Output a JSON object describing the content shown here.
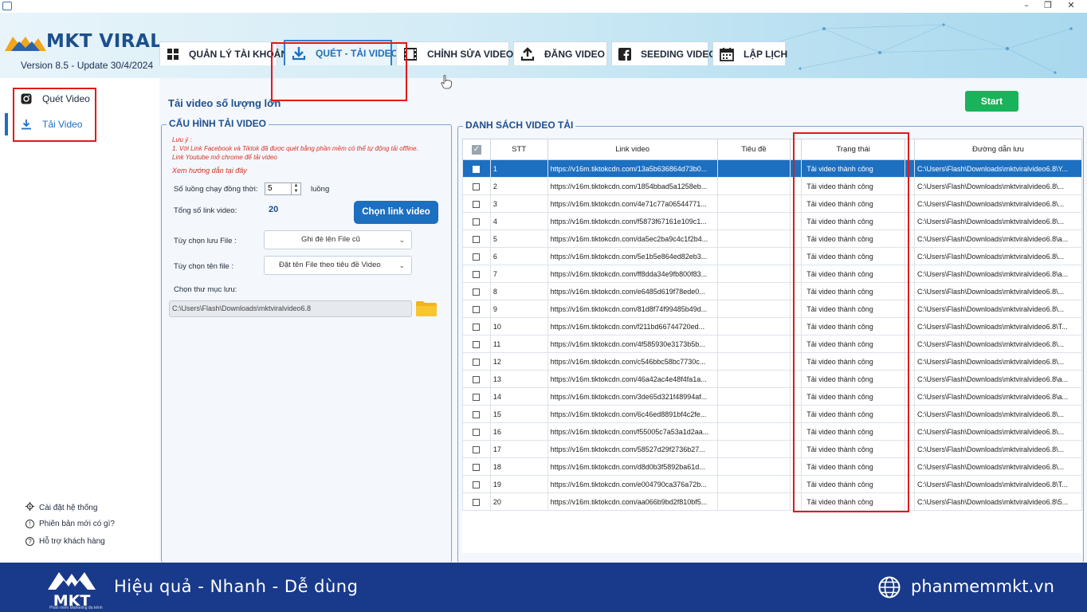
{
  "app": {
    "brand": "MKT VIRAL",
    "version": "Version  8.5 - Update 30/4/2024",
    "window_controls": [
      "–",
      "❐",
      "✕"
    ]
  },
  "tabs": [
    {
      "label": "QUẢN LÝ TÀI KHOẢN",
      "icon": "account-grid-icon"
    },
    {
      "label": "QUÉT - TẢI VIDEO",
      "icon": "download-icon",
      "active": true
    },
    {
      "label": "CHỈNH SỬA VIDEO",
      "icon": "film-icon"
    },
    {
      "label": "ĐĂNG VIDEO",
      "icon": "upload-icon"
    },
    {
      "label": "SEEDING VIDEO",
      "icon": "facebook-icon"
    },
    {
      "label": "LẬP LỊCH",
      "icon": "calendar-icon"
    }
  ],
  "sidebar": {
    "items": [
      {
        "label": "Quét Video",
        "icon": "instagram-icon"
      },
      {
        "label": "Tải Video",
        "icon": "download-icon",
        "active": true
      }
    ],
    "bottom": [
      {
        "label": "Cài đặt hệ thống",
        "icon": "gear-icon"
      },
      {
        "label": "Phiên bản mới có gì?",
        "icon": "info-icon"
      },
      {
        "label": "Hỗ trợ khách hàng",
        "icon": "help-icon"
      }
    ]
  },
  "main": {
    "title": "Tải video số lượng lớn",
    "start_label": "Start",
    "config": {
      "title": "CẤU HÌNH TẢI VIDEO",
      "note_lines": [
        "Lưu ý :",
        "1. Với Link Facebook và Tiktok đã được quét bằng phần mềm có thể tự động tải offline.",
        "Link Youtube mở chrome để tải video"
      ],
      "guide_link": "Xem hướng dẫn tại đây",
      "threads_label": "Số luồng chạy đồng thời:",
      "threads_value": "5",
      "threads_unit": "luồng",
      "total_label": "Tổng số link video:",
      "total_value": "20",
      "choose_button": "Chọn link video",
      "save_option_label": "Tùy chọn lưu File :",
      "save_option_value": "Ghi đè lên File cũ",
      "name_option_label": "Tùy chọn tên file :",
      "name_option_value": "Đặt tên File theo tiêu đề Video",
      "folder_label": "Chọn thư mục lưu:",
      "folder_value": "C:\\Users\\Flash\\Downloads\\mktviralvideo6.8"
    },
    "list": {
      "title": "DANH SÁCH VIDEO TẢI",
      "columns": [
        "STT",
        "Link video",
        "Tiêu đề",
        "Trạng thái",
        "Đường dẫn lưu"
      ],
      "rows": [
        [
          "1",
          "https://v16m.tiktokcdn.com/13a5b636864d73b0...",
          "",
          "Tải video thành công",
          "C:\\Users\\Flash\\Downloads\\mktviralvideo6.8\\Y..."
        ],
        [
          "2",
          "https://v16m.tiktokcdn.com/1854bbad5a1258eb...",
          "",
          "Tải video thành công",
          "C:\\Users\\Flash\\Downloads\\mktviralvideo6.8\\..."
        ],
        [
          "3",
          "https://v16m.tiktokcdn.com/4e71c77a06544771...",
          "",
          "Tải video thành công",
          "C:\\Users\\Flash\\Downloads\\mktviralvideo6.8\\..."
        ],
        [
          "4",
          "https://v16m.tiktokcdn.com/f5873f67161e109c1...",
          "",
          "Tải video thành công",
          "C:\\Users\\Flash\\Downloads\\mktviralvideo6.8\\..."
        ],
        [
          "5",
          "https://v16m.tiktokcdn.com/da5ec2ba9c4c1f2b4...",
          "",
          "Tải video thành công",
          "C:\\Users\\Flash\\Downloads\\mktviralvideo6.8\\a..."
        ],
        [
          "6",
          "https://v16m.tiktokcdn.com/5e1b5e864ed82eb3...",
          "",
          "Tải video thành công",
          "C:\\Users\\Flash\\Downloads\\mktviralvideo6.8\\..."
        ],
        [
          "7",
          "https://v16m.tiktokcdn.com/ff8dda34e9fb800f83...",
          "",
          "Tải video thành công",
          "C:\\Users\\Flash\\Downloads\\mktviralvideo6.8\\a..."
        ],
        [
          "8",
          "https://v16m.tiktokcdn.com/e6485d619f78ede0...",
          "",
          "Tải video thành công",
          "C:\\Users\\Flash\\Downloads\\mktviralvideo6.8\\..."
        ],
        [
          "9",
          "https://v16m.tiktokcdn.com/81d8f74f99485b49d...",
          "",
          "Tải video thành công",
          "C:\\Users\\Flash\\Downloads\\mktviralvideo6.8\\..."
        ],
        [
          "10",
          "https://v16m.tiktokcdn.com/f211bd66744720ed...",
          "",
          "Tải video thành công",
          "C:\\Users\\Flash\\Downloads\\mktviralvideo6.8\\T..."
        ],
        [
          "11",
          "https://v16m.tiktokcdn.com/4f585930e3173b5b...",
          "",
          "Tải video thành công",
          "C:\\Users\\Flash\\Downloads\\mktviralvideo6.8\\..."
        ],
        [
          "12",
          "https://v16m.tiktokcdn.com/c546bbc58bc7730c...",
          "",
          "Tải video thành công",
          "C:\\Users\\Flash\\Downloads\\mktviralvideo6.8\\..."
        ],
        [
          "13",
          "https://v16m.tiktokcdn.com/46a42ac4e48f4fa1a...",
          "",
          "Tải video thành công",
          "C:\\Users\\Flash\\Downloads\\mktviralvideo6.8\\a..."
        ],
        [
          "14",
          "https://v16m.tiktokcdn.com/3de65d321f48994af...",
          "",
          "Tải video thành công",
          "C:\\Users\\Flash\\Downloads\\mktviralvideo6.8\\a..."
        ],
        [
          "15",
          "https://v16m.tiktokcdn.com/6c46ed8891bf4c2fe...",
          "",
          "Tải video thành công",
          "C:\\Users\\Flash\\Downloads\\mktviralvideo6.8\\..."
        ],
        [
          "16",
          "https://v16m.tiktokcdn.com/f55005c7a53a1d2aa...",
          "",
          "Tải video thành công",
          "C:\\Users\\Flash\\Downloads\\mktviralvideo6.8\\..."
        ],
        [
          "17",
          "https://v16m.tiktokcdn.com/58527d29f2736b27...",
          "",
          "Tải video thành công",
          "C:\\Users\\Flash\\Downloads\\mktviralvideo6.8\\..."
        ],
        [
          "18",
          "https://v16m.tiktokcdn.com/d8d0b3f5892ba61d...",
          "",
          "Tải video thành công",
          "C:\\Users\\Flash\\Downloads\\mktviralvideo6.8\\..."
        ],
        [
          "19",
          "https://v16m.tiktokcdn.com/e004790ca376a72b...",
          "",
          "Tải video thành công",
          "C:\\Users\\Flash\\Downloads\\mktviralvideo6.8\\T..."
        ],
        [
          "20",
          "https://v16m.tiktokcdn.com/aa066b9bd2f810bf5...",
          "",
          "Tải video thành công",
          "C:\\Users\\Flash\\Downloads\\mktviralvideo6.8\\5..."
        ]
      ]
    }
  },
  "footer": {
    "tagline": "Hiệu quả - Nhanh - Dễ dùng",
    "website": "phanmemmkt.vn",
    "logo_text": "MKT",
    "logo_sub": "Phần mềm Marketing đa kênh"
  },
  "colors": {
    "accent": "#1d6fc0",
    "start": "#19b35b",
    "highlight_box": "#e01a1a",
    "footer": "#193a8a"
  }
}
